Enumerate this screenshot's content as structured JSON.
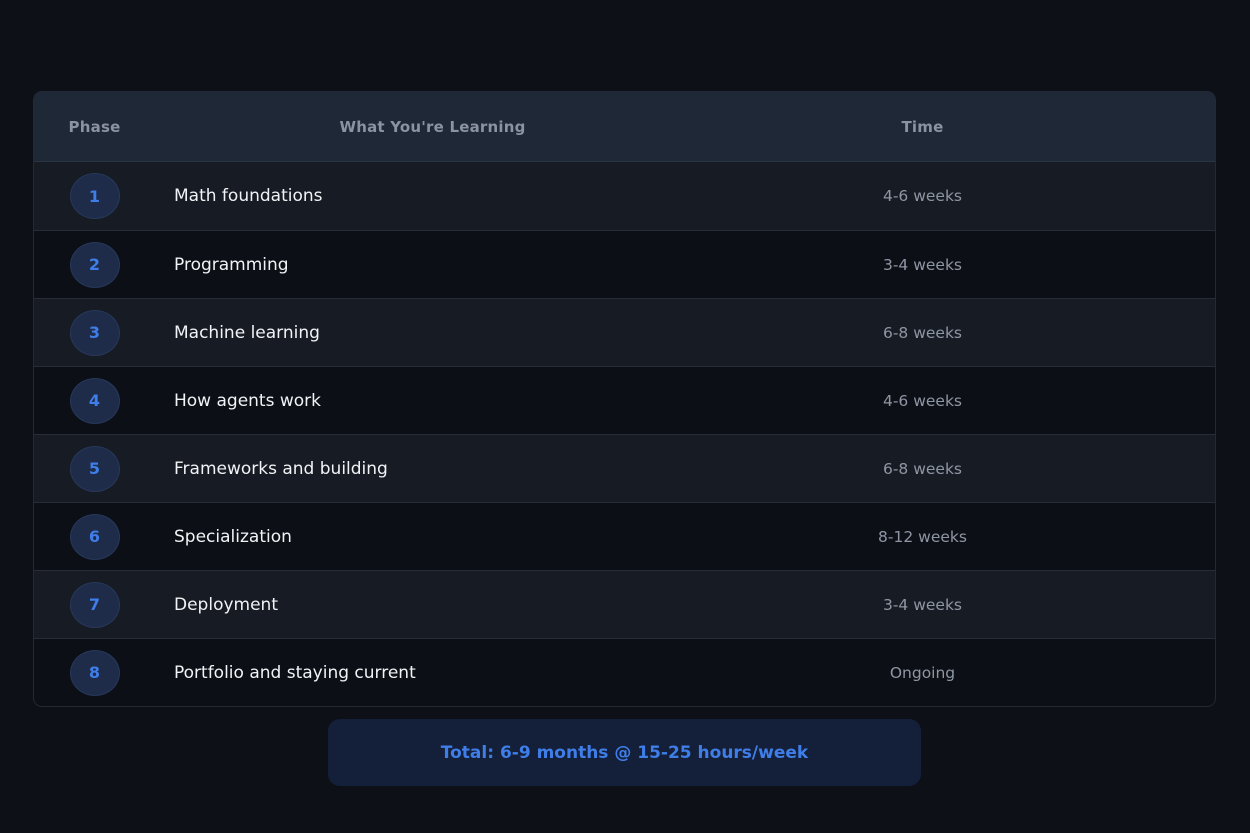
{
  "table": {
    "headers": {
      "phase": "Phase",
      "topic": "What You're Learning",
      "time": "Time"
    },
    "rows": [
      {
        "phase": "1",
        "topic": "Math foundations",
        "time": "4-6 weeks"
      },
      {
        "phase": "2",
        "topic": "Programming",
        "time": "3-4 weeks"
      },
      {
        "phase": "3",
        "topic": "Machine learning",
        "time": "6-8 weeks"
      },
      {
        "phase": "4",
        "topic": "How agents work",
        "time": "4-6 weeks"
      },
      {
        "phase": "5",
        "topic": "Frameworks and building",
        "time": "6-8 weeks"
      },
      {
        "phase": "6",
        "topic": "Specialization",
        "time": "8-12 weeks"
      },
      {
        "phase": "7",
        "topic": "Deployment",
        "time": "3-4 weeks"
      },
      {
        "phase": "8",
        "topic": "Portfolio and staying current",
        "time": "Ongoing"
      }
    ]
  },
  "summary": {
    "total": "Total: 6-9 months @ 15-25 hours/week"
  },
  "colors": {
    "background": "#0d1017",
    "header_background": "#1f2837",
    "accent": "#3f7ee8",
    "badge_background": "#1e2c4a",
    "row_odd": "#171b23",
    "row_even": "#0c0f15"
  }
}
